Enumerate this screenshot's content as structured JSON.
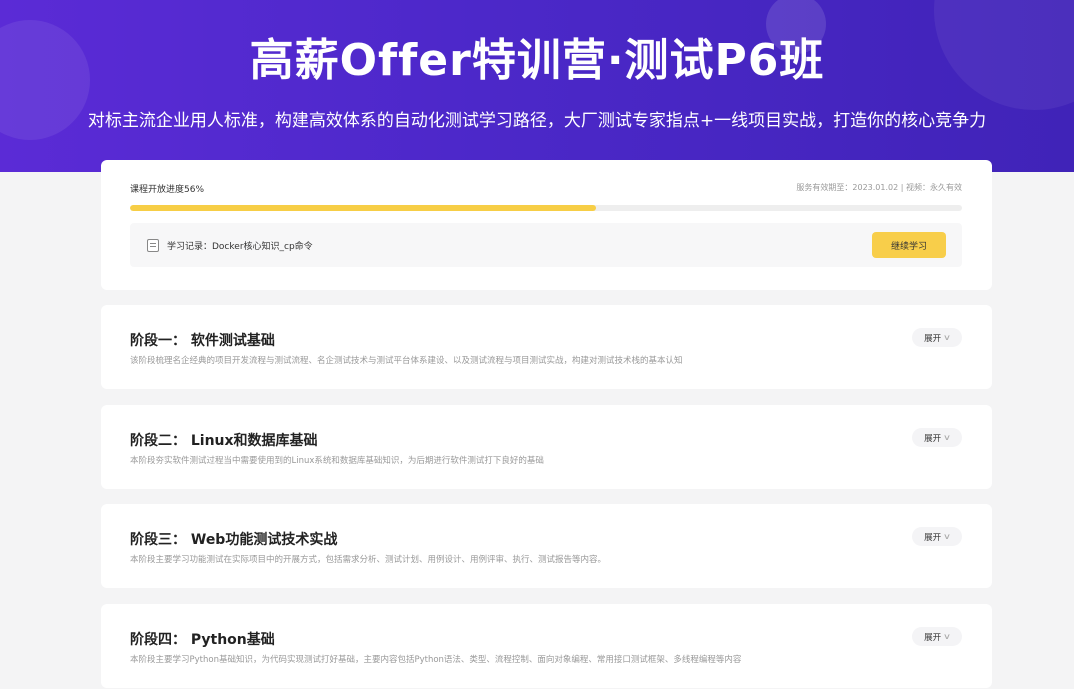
{
  "banner": {
    "title": "高薪Offer特训营·测试P6班",
    "subtitle": "对标主流企业用人标准，构建高效体系的自动化测试学习路径，大厂测试专家指点+一线项目实战，打造你的核心竞争力"
  },
  "progress": {
    "label": "课程开放进度56%",
    "percent": 56,
    "meta": "服务有效期至：2023.01.02 | 视频：永久有效",
    "record_label": "学习记录：Docker核心知识_cp命令",
    "continue_label": "继续学习",
    "fill_color": "#f7ce46"
  },
  "stages": [
    {
      "title": "阶段一：  软件测试基础",
      "desc": "该阶段梳理名企经典的项目开发流程与测试流程、名企测试技术与测试平台体系建设、以及测试流程与项目测试实战，构建对测试技术栈的基本认知",
      "expand_label": "展开"
    },
    {
      "title": "阶段二：  Linux和数据库基础",
      "desc": "本阶段夯实软件测试过程当中需要使用到的Linux系统和数据库基础知识，为后期进行软件测试打下良好的基础",
      "expand_label": "展开"
    },
    {
      "title": "阶段三：  Web功能测试技术实战",
      "desc": "本阶段主要学习功能测试在实际项目中的开展方式，包括需求分析、测试计划、用例设计、用例评审、执行、测试报告等内容。",
      "expand_label": "展开"
    },
    {
      "title": "阶段四：  Python基础",
      "desc": "本阶段主要学习Python基础知识，为代码实现测试打好基础，主要内容包括Python语法、类型、流程控制、面向对象编程、常用接口测试框架、多线程编程等内容",
      "expand_label": "展开"
    }
  ]
}
